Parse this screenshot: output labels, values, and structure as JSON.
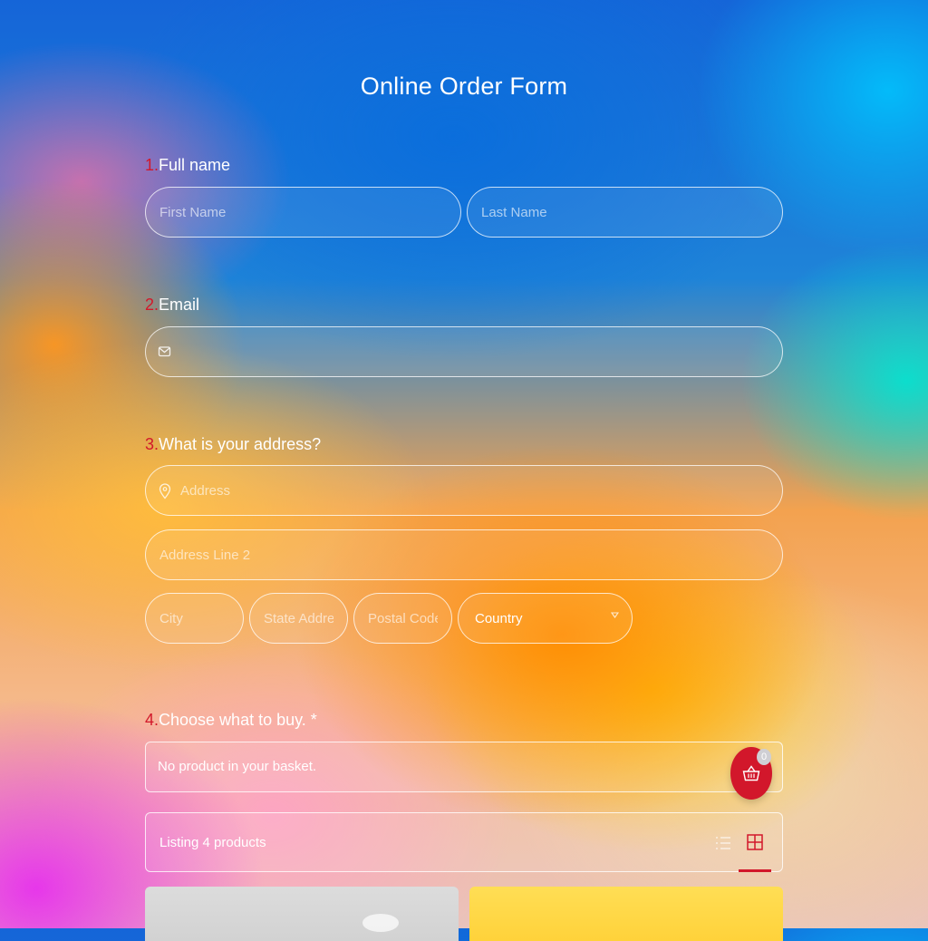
{
  "form": {
    "title": "Online Order Form"
  },
  "questions": {
    "q1": {
      "num": "1.",
      "label": "Full name",
      "first_placeholder": "First Name",
      "last_placeholder": "Last Name"
    },
    "q2": {
      "num": "2.",
      "label": "Email",
      "email_placeholder": ""
    },
    "q3": {
      "num": "3.",
      "label": "What is your address?",
      "address_placeholder": "Address",
      "address2_placeholder": "Address Line 2",
      "city_placeholder": "City",
      "state_placeholder": "State Address",
      "postal_placeholder": "Postal Code",
      "country_value": "Country"
    },
    "q4": {
      "num": "4.",
      "label": "Choose what to buy. *"
    }
  },
  "basket": {
    "empty_text": "No product in your basket.",
    "count": "0"
  },
  "listing": {
    "text": "Listing 4 products"
  },
  "icons": {
    "email": "mail-icon",
    "address": "location-pin-icon",
    "caret": "chevron-down-icon",
    "cart": "basket-icon",
    "list_view": "list-view-icon",
    "grid_view": "grid-view-icon"
  },
  "colors": {
    "accent": "#d2172b",
    "text": "#ffffff"
  }
}
